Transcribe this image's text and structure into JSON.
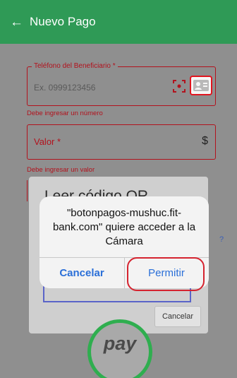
{
  "header": {
    "back_icon": "←",
    "title": "Nuevo Pago"
  },
  "form": {
    "phone_label": "Teléfono del Beneficiario *",
    "phone_placeholder": "Ex. 0999123456",
    "phone_error": "Debe ingresar un número",
    "value_label": "Valor *",
    "value_icon": "$",
    "value_error": "Debe ingresar un valor"
  },
  "scanner": {
    "title_peek": "Leer código QR",
    "cancel_label": "Cancelar",
    "side_mark": "?"
  },
  "logo": {
    "text": "pay",
    "ring_color": "#2fae4f"
  },
  "alert": {
    "message": "\"botonpagos-mushuc.fit-bank.com\" quiere acceder a la Cámara",
    "cancel_label": "Cancelar",
    "allow_label": "Permitir"
  },
  "colors": {
    "header": "#2f9a56",
    "error": "#b2121d",
    "ios_blue": "#2a6fd8",
    "highlight": "#d5232f"
  }
}
